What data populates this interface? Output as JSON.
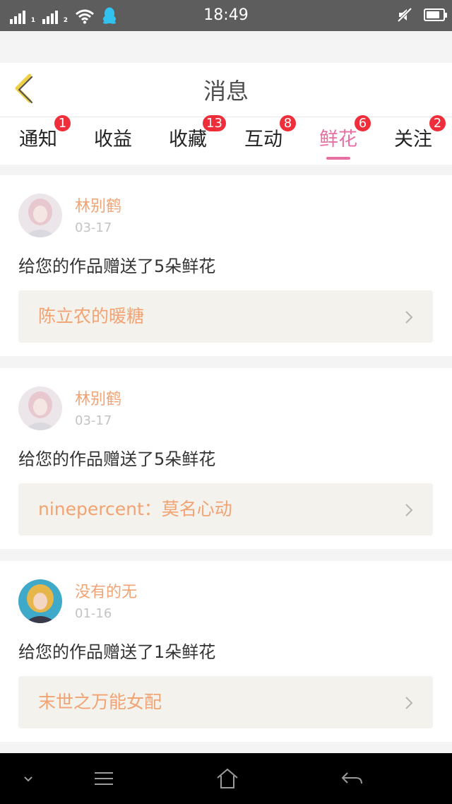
{
  "status_bar": {
    "time": "18:49",
    "sim1": "1",
    "sim2": "2"
  },
  "header": {
    "title": "消息"
  },
  "tabs": [
    {
      "label": "通知",
      "badge": "1"
    },
    {
      "label": "收益",
      "badge": ""
    },
    {
      "label": "收藏",
      "badge": "13"
    },
    {
      "label": "互动",
      "badge": "8"
    },
    {
      "label": "鲜花",
      "badge": "6",
      "active": true
    },
    {
      "label": "关注",
      "badge": "2"
    }
  ],
  "messages": [
    {
      "sender": "林别鹤",
      "date": "03-17",
      "text": "给您的作品赠送了5朵鲜花",
      "work": "陈立农的暖糖"
    },
    {
      "sender": "林别鹤",
      "date": "03-17",
      "text": "给您的作品赠送了5朵鲜花",
      "work": "ninepercent：莫名心动"
    },
    {
      "sender": "没有的无",
      "date": "01-16",
      "text": "给您的作品赠送了1朵鲜花",
      "work": "末世之万能女配"
    }
  ],
  "colors": {
    "accent_pink": "#e86fa2",
    "accent_orange": "#f2a374",
    "badge_red": "#ef2e3b",
    "back_arrow_yellow": "#f0d146"
  },
  "icons": {
    "back": "chevron-left-icon",
    "wifi": "wifi-icon",
    "qq": "qq-penguin-icon",
    "mute": "mute-icon",
    "battery": "battery-icon",
    "nav_down": "chevron-down-icon",
    "nav_menu": "menu-icon",
    "nav_home": "home-icon",
    "nav_back": "back-arrow-icon"
  },
  "battery_level": 0.8
}
